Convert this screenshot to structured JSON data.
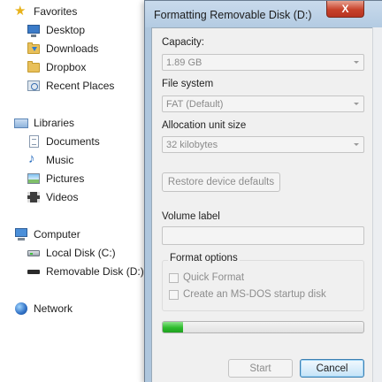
{
  "nav": {
    "favorites": {
      "label": "Favorites",
      "icon": "star-icon"
    },
    "favorites_items": [
      {
        "label": "Desktop",
        "icon": "desktop-icon"
      },
      {
        "label": "Downloads",
        "icon": "downloads-folder-icon"
      },
      {
        "label": "Dropbox",
        "icon": "dropbox-icon"
      },
      {
        "label": "Recent Places",
        "icon": "recent-places-icon"
      }
    ],
    "libraries": {
      "label": "Libraries",
      "icon": "libraries-icon"
    },
    "libraries_items": [
      {
        "label": "Documents",
        "icon": "documents-icon"
      },
      {
        "label": "Music",
        "icon": "music-icon"
      },
      {
        "label": "Pictures",
        "icon": "pictures-icon"
      },
      {
        "label": "Videos",
        "icon": "videos-icon"
      }
    ],
    "computer": {
      "label": "Computer",
      "icon": "computer-icon"
    },
    "computer_items": [
      {
        "label": "Local Disk (C:)",
        "icon": "local-disk-icon"
      },
      {
        "label": "Removable Disk (D:)",
        "icon": "removable-disk-icon"
      }
    ],
    "network": {
      "label": "Network",
      "icon": "network-icon"
    }
  },
  "dialog": {
    "title": "Formatting Removable Disk (D:)",
    "close_label": "X",
    "capacity": {
      "label": "Capacity:",
      "value": "1.89 GB"
    },
    "file_system": {
      "label": "File system",
      "value": "FAT (Default)"
    },
    "allocation": {
      "label": "Allocation unit size",
      "value": "32 kilobytes"
    },
    "restore_label": "Restore device defaults",
    "volume_label": {
      "label": "Volume label",
      "value": ""
    },
    "format_options": {
      "legend": "Format options",
      "quick_format": {
        "label": "Quick Format",
        "checked": false
      },
      "msdos": {
        "label": "Create an MS-DOS startup disk",
        "checked": false
      }
    },
    "progress_fraction": 0.1,
    "start_label": "Start",
    "cancel_label": "Cancel"
  },
  "colors": {
    "progress_fill": "#2ebc2e",
    "close_button": "#c7422b",
    "selection": "#e5eff9"
  }
}
